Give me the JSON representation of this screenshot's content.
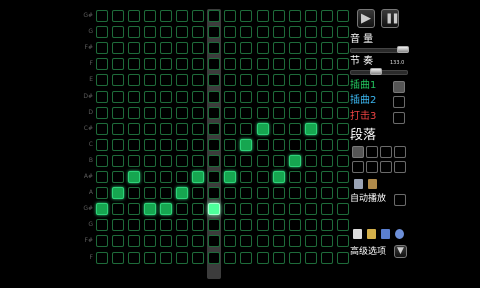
{
  "grid": {
    "rows": [
      "G#",
      "G",
      "F#",
      "F",
      "E",
      "D#",
      "D",
      "C#",
      "C",
      "B",
      "A#",
      "A",
      "G#",
      "G",
      "F#",
      "F",
      "E",
      "D#",
      "D",
      "C#",
      "C",
      "B",
      "A#",
      "A",
      "G#",
      "G"
    ],
    "columns": 16,
    "playhead_column": 7,
    "active_cells": [
      {
        "row": 7,
        "col": 10
      },
      {
        "row": 7,
        "col": 13
      },
      {
        "row": 8,
        "col": 9
      },
      {
        "row": 9,
        "col": 12
      },
      {
        "row": 10,
        "col": 2
      },
      {
        "row": 10,
        "col": 6
      },
      {
        "row": 10,
        "col": 8
      },
      {
        "row": 10,
        "col": 11
      },
      {
        "row": 11,
        "col": 1
      },
      {
        "row": 11,
        "col": 5
      },
      {
        "row": 12,
        "col": 0
      },
      {
        "row": 12,
        "col": 3
      },
      {
        "row": 12,
        "col": 4
      },
      {
        "row": 12,
        "col": 7,
        "highlight": true
      }
    ]
  },
  "panel": {
    "play_label": "▶",
    "pause_label": "❚❚",
    "volume_label": "音 量",
    "volume_level": 0.92,
    "tempo_label": "节 奏",
    "tempo_value": "133.0",
    "tempo_level": 0.45,
    "tracks": [
      {
        "label": "插曲1",
        "color": "#22c55e"
      },
      {
        "label": "插曲2",
        "color": "#3bb6f0"
      },
      {
        "label": "打击3",
        "color": "#ef4444"
      }
    ],
    "section_label": "段落",
    "autoplay_label": "自动播放",
    "advanced_label": "高级选项",
    "icons": {
      "copy": "copy-icon",
      "paste": "paste-icon",
      "new": "new-file-icon",
      "open": "open-folder-icon",
      "save": "save-icon",
      "share": "share-icon"
    }
  }
}
